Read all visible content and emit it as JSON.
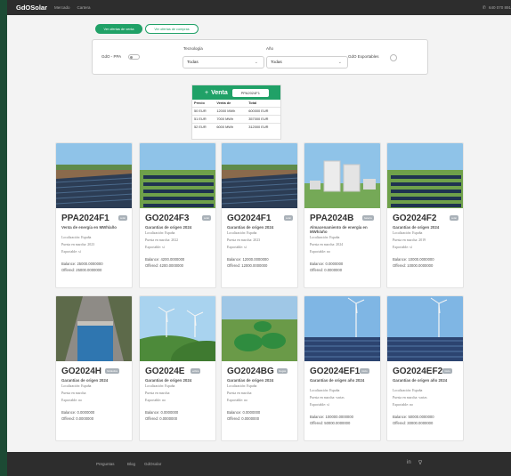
{
  "nav": {
    "brand": "GdOSolar",
    "links": [
      "Mercado",
      "Cartera"
    ],
    "phone": "640 070 891"
  },
  "toggles": {
    "sales": "Ver ofertas de venta",
    "purchases": "Ver ofertas de compras"
  },
  "filters": {
    "gdo_ppa_label": "GdO - PPA",
    "tecnologia_label": "Tecnología",
    "tecnologia_value": "Todas",
    "anio_label": "Año",
    "anio_value": "Todas",
    "exportables_label": "GdO Exportables"
  },
  "venta": {
    "title": "Venta",
    "selected": "PPA2024F1",
    "headers": [
      "Precio",
      "Venta de",
      "Total"
    ],
    "rows": [
      [
        "50 EUR",
        "12000 MWh",
        "600000 EUR"
      ],
      [
        "51 EUR",
        "7000 MWh",
        "357000 EUR"
      ],
      [
        "52 EUR",
        "6000 MWh",
        "312000 EUR"
      ]
    ]
  },
  "labels": {
    "localizacion": "Localización:",
    "puesta": "Puesta en marcha:",
    "exportable": "Exportable:",
    "balance": "Balance:",
    "offered": "Offered:"
  },
  "cards": [
    {
      "title": "PPA2024F1",
      "badge": "solar",
      "subtitle": "Venta de energía en MWh/año",
      "location": "España",
      "start": "2023",
      "exportable": "sí",
      "balance": "25000.0000000",
      "offered": "25000.0000000",
      "image": "solar-field"
    },
    {
      "title": "GO2024F3",
      "badge": "solar",
      "subtitle": "Garantías de origen 2024",
      "location": "España",
      "start": "2022",
      "exportable": "sí",
      "balance": "4200.0000000",
      "offered": "4200.0000000",
      "image": "solar-rows"
    },
    {
      "title": "GO2024F1",
      "badge": "solar",
      "subtitle": "Garantías de origen 2024",
      "location": "España",
      "start": "2023",
      "exportable": "sí",
      "balance": "12000.0000000",
      "offered": "12000.0000000",
      "image": "solar-field"
    },
    {
      "title": "PPA2024B",
      "badge": "batería",
      "subtitle": "Almacenamiento de energía en MWh/año",
      "location": "España",
      "start": "2024",
      "exportable": "no",
      "balance": "0.0000000",
      "offered": "0.0000000",
      "image": "battery"
    },
    {
      "title": "GO2024F2",
      "badge": "solar",
      "subtitle": "Garantías de origen 2024",
      "location": "España",
      "start": "2019",
      "exportable": "sí",
      "balance": "10000.0000000",
      "offered": "10000.0000000",
      "image": "solar-rows"
    },
    {
      "title": "GO2024H",
      "badge": "hidráulica",
      "subtitle": "Garantías de origen 2024",
      "location": "España",
      "start": "",
      "exportable": "no",
      "balance": "0.0000000",
      "offered": "0.0000000",
      "image": "hydro"
    },
    {
      "title": "GO2024E",
      "badge": "eólica",
      "subtitle": "Garantías de origen 2024",
      "location": "España",
      "start": "",
      "exportable": "no",
      "balance": "0.0000000",
      "offered": "0.0000000",
      "image": "wind-hills"
    },
    {
      "title": "GO2024BG",
      "badge": "biogás",
      "subtitle": "Garantías de origen 2024",
      "location": "España",
      "start": "",
      "exportable": "no",
      "balance": "0.0000000",
      "offered": "0.0000000",
      "image": "biogas"
    },
    {
      "title": "GO2024EF1",
      "badge": "mixto",
      "subtitle": "Garantías de origen año 2024",
      "location": "España",
      "start": "varias",
      "exportable": "sí",
      "balance": "100000.0000000",
      "offered": "50000.0000000",
      "image": "wind-solar"
    },
    {
      "title": "GO2024EF2",
      "badge": "mixto",
      "subtitle": "Garantías de origen año 2024",
      "location": "España",
      "start": "varias",
      "exportable": "no",
      "balance": "50000.0000000",
      "offered": "30000.0000000",
      "image": "wind-solar"
    }
  ],
  "footer": {
    "links": [
      "Preguntas",
      "Blog",
      "GdOsolar"
    ],
    "icons": [
      "linkedin-icon",
      "twitter-icon"
    ]
  }
}
